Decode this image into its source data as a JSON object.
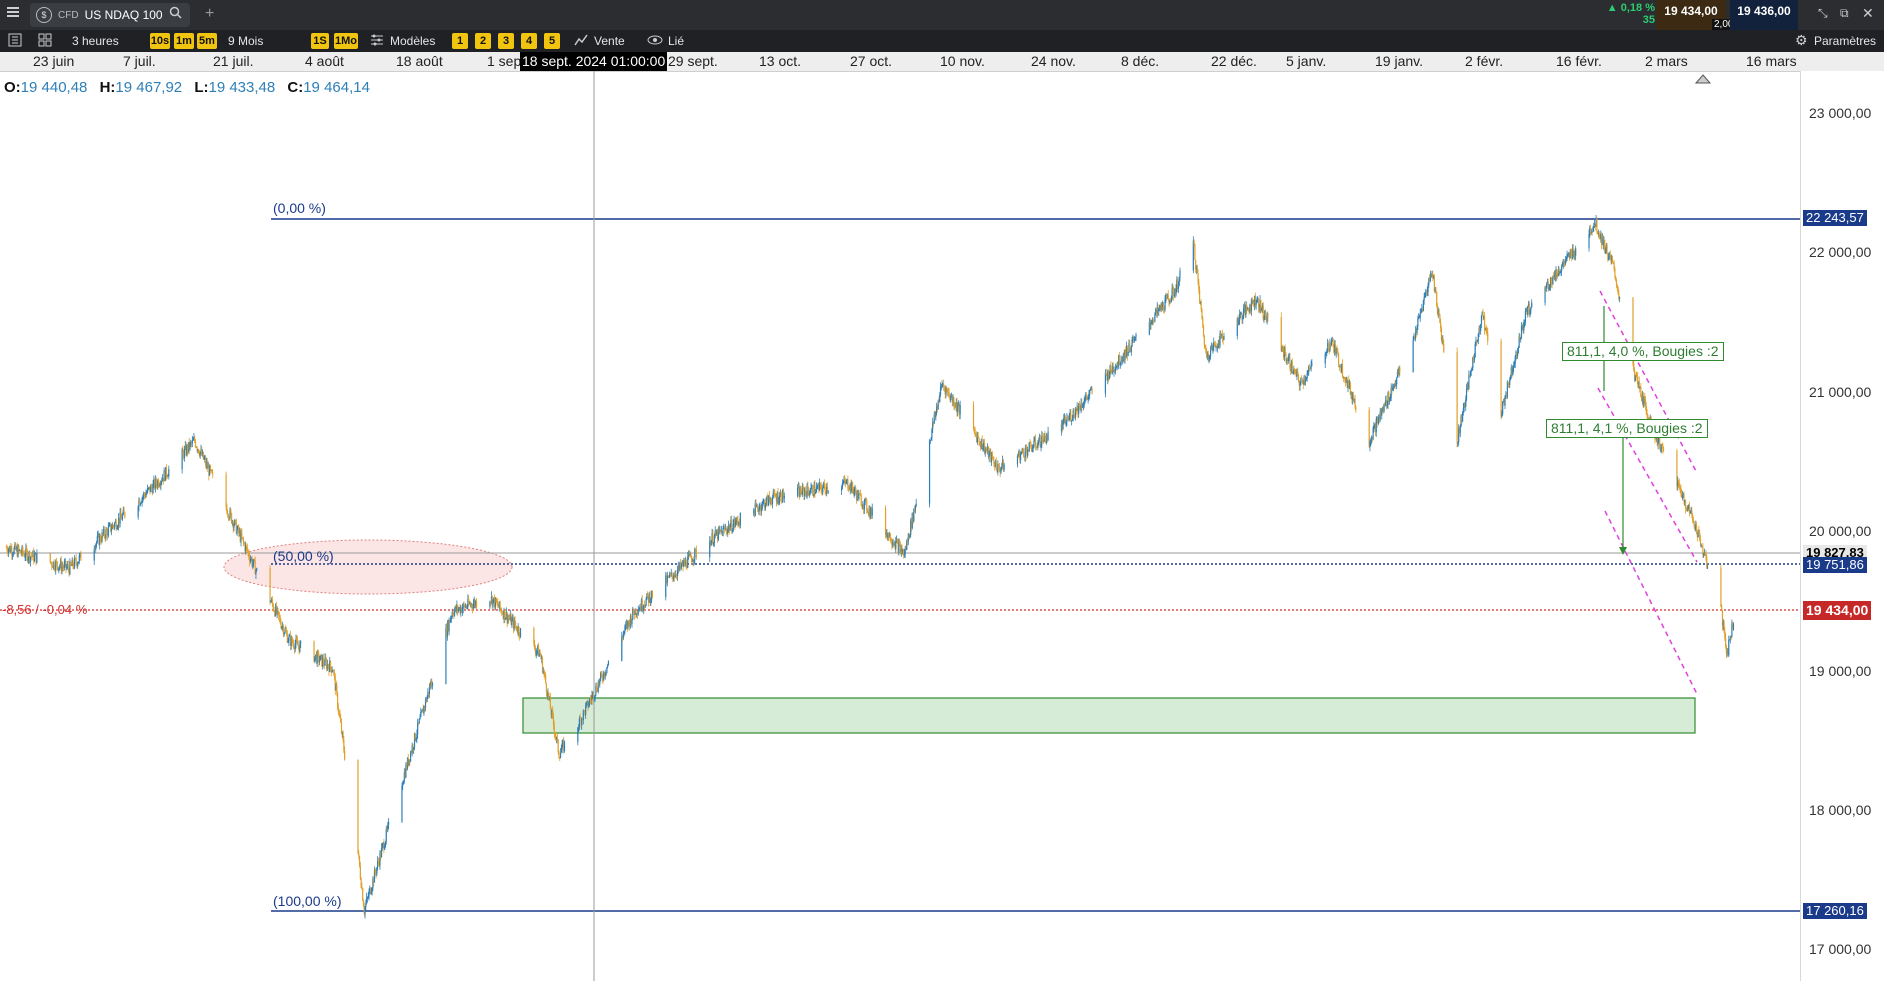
{
  "header": {
    "instrument_type": "CFD",
    "instrument_name": "US NDAQ 100",
    "add_tab": "+",
    "change_pct": "0,18 %",
    "change_count": "35",
    "bid": "19 434,00",
    "ask": "19 436,00",
    "spread": "2,00"
  },
  "toolbar": {
    "timeframe": "3 heures",
    "tf_buttons": [
      "10s",
      "1m",
      "5m"
    ],
    "range": "9 Mois",
    "range_buttons": [
      "1S",
      "1Mo"
    ],
    "models": "Modèles",
    "quick_buttons": [
      "1",
      "2",
      "3",
      "4",
      "5"
    ],
    "vente": "Vente",
    "lie": "Lié",
    "settings": "Paramètres"
  },
  "date_axis": {
    "labels": [
      "23 juin",
      "7 juil.",
      "21 juil.",
      "4 août",
      "18 août",
      "1 sep",
      "29 sept.",
      "13 oct.",
      "27 oct.",
      "10 nov.",
      "24 nov.",
      "8 déc.",
      "22 déc.",
      "5 janv.",
      "19 janv.",
      "2 févr.",
      "16 févr.",
      "2 mars",
      "16 mars"
    ],
    "crosshair_label": "18 sept. 2024 01:00:00"
  },
  "ohlc": {
    "o_label": "O:",
    "o": "19 440,48",
    "h_label": "H:",
    "h": "19 467,92",
    "l_label": "L:",
    "l": "19 433,48",
    "c_label": "C:",
    "c": "19 464,14"
  },
  "price_axis": {
    "labels": [
      "23 000,00",
      "22 000,00",
      "21 000,00",
      "20 000,00",
      "19 000,00",
      "18 000,00",
      "17 000,00"
    ],
    "tag_fib0": "22 243,57",
    "tag_crosshair": "19 827,83",
    "tag_fib50": "19 751,86",
    "tag_current": "19 434,00",
    "tag_fib100": "17 260,16"
  },
  "fib": {
    "level0": "(0,00 %)",
    "level50": "(50,00 %)",
    "level100": "(100,00 %)"
  },
  "current_price_change": "-8,56 / -0,04 %",
  "annotations": [
    "811,1, 4,0 %, Bougies :2",
    "811,1, 4,1 %, Bougies :2"
  ],
  "colors": {
    "up_candle": "#2e7fb8",
    "down_candle": "#e0a02a",
    "fib_line": "#1a3a8a",
    "current_price": "#d32f2f",
    "accent_yellow": "#f1c40f",
    "positive": "#2ecc71"
  },
  "chart_data": {
    "type": "candlestick",
    "price_range": [
      16900,
      23300
    ],
    "waypoints_date_price": [
      [
        "2024-06-10",
        19950
      ],
      [
        "2024-06-20",
        19800
      ],
      [
        "2024-07-05",
        20450
      ],
      [
        "2024-07-10",
        20700
      ],
      [
        "2024-07-17",
        20050
      ],
      [
        "2024-07-25",
        19300
      ],
      [
        "2024-08-01",
        19100
      ],
      [
        "2024-08-05",
        17800
      ],
      [
        "2024-08-06",
        17400
      ],
      [
        "2024-08-12",
        18300
      ],
      [
        "2024-08-20",
        19500
      ],
      [
        "2024-08-26",
        19600
      ],
      [
        "2024-09-03",
        19200
      ],
      [
        "2024-09-06",
        18500
      ],
      [
        "2024-09-09",
        18700
      ],
      [
        "2024-09-18",
        19500
      ],
      [
        "2024-09-30",
        20000
      ],
      [
        "2024-10-10",
        20300
      ],
      [
        "2024-10-22",
        20400
      ],
      [
        "2024-10-31",
        19900
      ],
      [
        "2024-11-06",
        21100
      ],
      [
        "2024-11-15",
        20500
      ],
      [
        "2024-11-25",
        20800
      ],
      [
        "2024-12-03",
        21200
      ],
      [
        "2024-12-13",
        21750
      ],
      [
        "2024-12-16",
        22100
      ],
      [
        "2024-12-18",
        21300
      ],
      [
        "2024-12-20",
        21400
      ],
      [
        "2024-12-26",
        21700
      ],
      [
        "2025-01-02",
        21100
      ],
      [
        "2025-01-07",
        21400
      ],
      [
        "2025-01-13",
        20700
      ],
      [
        "2025-01-20",
        21400
      ],
      [
        "2025-01-23",
        21900
      ],
      [
        "2025-01-27",
        20700
      ],
      [
        "2025-01-31",
        21600
      ],
      [
        "2025-02-03",
        20900
      ],
      [
        "2025-02-07",
        21600
      ],
      [
        "2025-02-18",
        22230
      ],
      [
        "2025-02-21",
        21900
      ],
      [
        "2025-02-24",
        21200
      ],
      [
        "2025-02-27",
        20800
      ],
      [
        "2025-03-03",
        20400
      ],
      [
        "2025-03-06",
        20100
      ],
      [
        "2025-03-10",
        19500
      ],
      [
        "2025-03-11",
        19200
      ],
      [
        "2025-03-12",
        19440
      ]
    ]
  }
}
